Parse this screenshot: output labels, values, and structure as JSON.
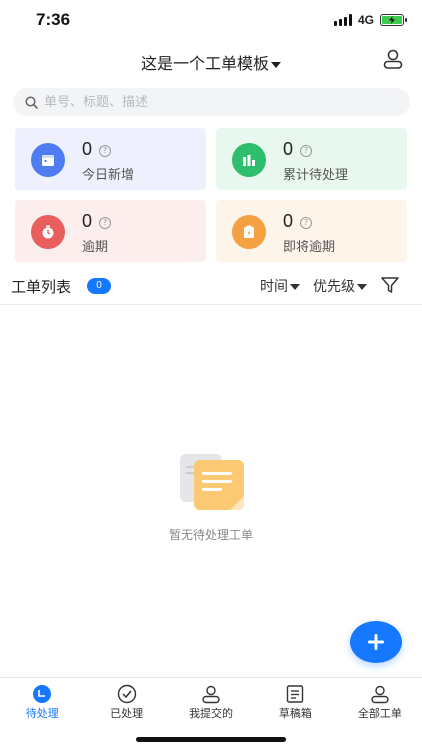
{
  "status": {
    "time": "7:36",
    "network": "4G"
  },
  "header": {
    "title": "这是一个工单模板"
  },
  "search": {
    "placeholder": "单号、标题、描述"
  },
  "stats": [
    {
      "value": "0",
      "label": "今日新增",
      "bg": "#eef0fd",
      "icon_color": "#4f7cf0",
      "icon": "calendar-icon"
    },
    {
      "value": "0",
      "label": "累计待处理",
      "bg": "#e9f8ef",
      "icon_color": "#2fbd6e",
      "icon": "bar-chart-icon"
    },
    {
      "value": "0",
      "label": "逾期",
      "bg": "#fdeeee",
      "icon_color": "#ea5e5e",
      "icon": "alarm-clock-icon"
    },
    {
      "value": "0",
      "label": "即将逾期",
      "bg": "#fdf5ea",
      "icon_color": "#f5a042",
      "icon": "hourglass-icon"
    }
  ],
  "list": {
    "title": "工单列表",
    "count": "0",
    "sort_time": "时间",
    "sort_priority": "优先级"
  },
  "empty": {
    "text": "暂无待处理工单"
  },
  "tabs": [
    {
      "label": "待处理",
      "active": true
    },
    {
      "label": "已处理",
      "active": false
    },
    {
      "label": "我提交的",
      "active": false
    },
    {
      "label": "草稿箱",
      "active": false
    },
    {
      "label": "全部工单",
      "active": false
    }
  ],
  "colors": {
    "accent": "#1677ff"
  }
}
